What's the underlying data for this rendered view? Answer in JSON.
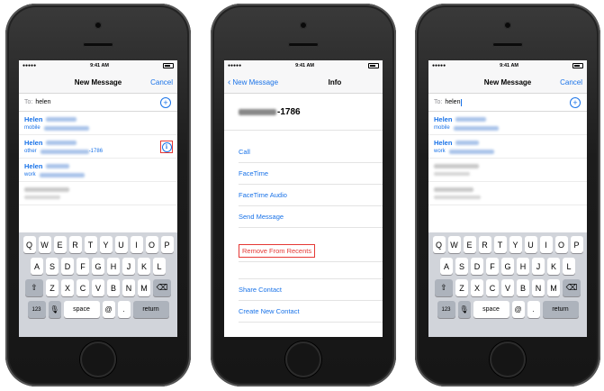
{
  "status": {
    "time": "9:41 AM",
    "signal": "●●●●●",
    "wifi": "≈"
  },
  "left": {
    "nav": {
      "title": "New Message",
      "cancel": "Cancel"
    },
    "to": {
      "label": "To:",
      "value": "helen"
    },
    "rows": [
      {
        "name": "Helen",
        "type": "mobile",
        "suffix": ""
      },
      {
        "name": "Helen",
        "type": "other",
        "suffix": "-1786"
      },
      {
        "name": "Helen",
        "type": "work",
        "suffix": ""
      }
    ]
  },
  "middle": {
    "nav": {
      "back": "New Message",
      "title": "Info"
    },
    "number_suffix": "-1786",
    "actions": [
      "Call",
      "FaceTime",
      "FaceTime Audio",
      "Send Message"
    ],
    "remove": "Remove From Recents",
    "actions2": [
      "Share Contact",
      "Create New Contact"
    ]
  },
  "right": {
    "nav": {
      "title": "New Message",
      "cancel": "Cancel"
    },
    "to": {
      "label": "To:",
      "value": "helen"
    },
    "rows": [
      {
        "name": "Helen",
        "type": "mobile"
      },
      {
        "name": "Helen",
        "type": "work"
      }
    ]
  },
  "keyboard": {
    "row1": [
      "Q",
      "W",
      "E",
      "R",
      "T",
      "Y",
      "U",
      "I",
      "O",
      "P"
    ],
    "row2": [
      "A",
      "S",
      "D",
      "F",
      "G",
      "H",
      "J",
      "K",
      "L"
    ],
    "row3": [
      "Z",
      "X",
      "C",
      "V",
      "B",
      "N",
      "M"
    ],
    "num": "123",
    "space": "space",
    "at": "@",
    "dot": ".",
    "return": "return"
  },
  "colors": {
    "accent": "#1a73e8",
    "highlight": "#e53935"
  }
}
